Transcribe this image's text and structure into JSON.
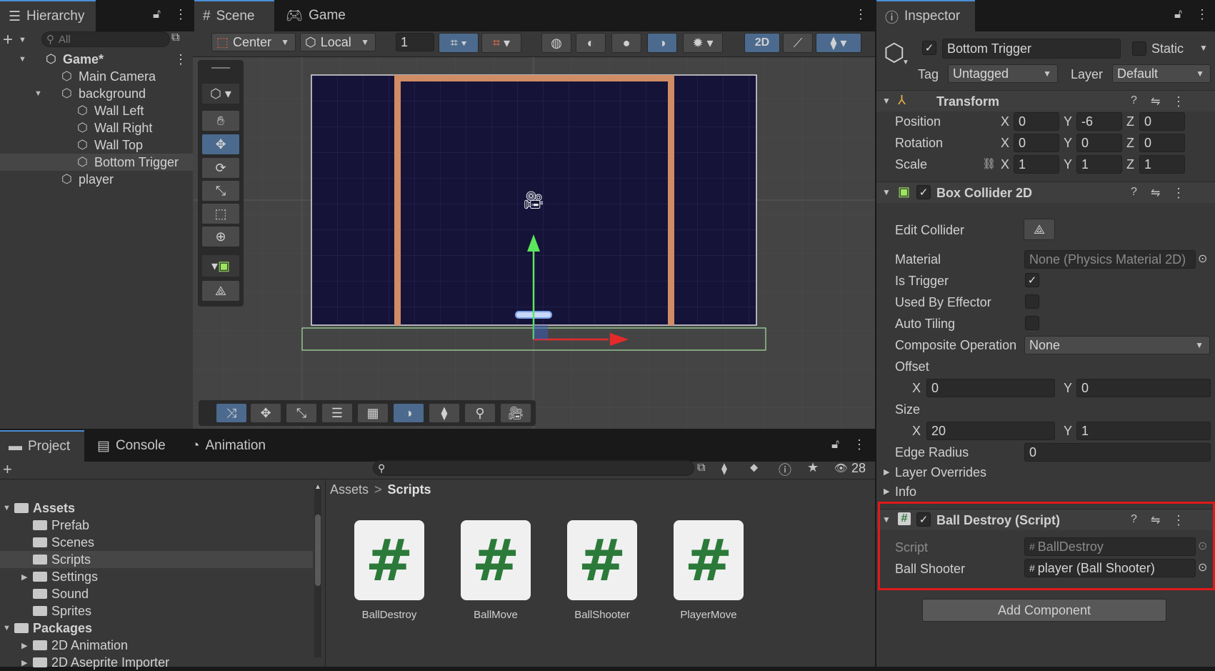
{
  "hierarchy": {
    "tab_label": "Hierarchy",
    "search_placeholder": "All",
    "items": [
      {
        "label": "Game*",
        "level": 0
      },
      {
        "label": "Main Camera",
        "level": 1
      },
      {
        "label": "background",
        "level": 1
      },
      {
        "label": "Wall Left",
        "level": 2
      },
      {
        "label": "Wall Right",
        "level": 2
      },
      {
        "label": "Wall Top",
        "level": 2
      },
      {
        "label": "Bottom Trigger",
        "level": 2
      },
      {
        "label": "player",
        "level": 1
      }
    ]
  },
  "scene": {
    "tabs": [
      "Scene",
      "Game"
    ],
    "pivot_label": "Center",
    "space_label": "Local",
    "snap_value": "1",
    "mode_2d_label": "2D"
  },
  "project": {
    "tabs": [
      "Project",
      "Console",
      "Animation"
    ],
    "visible_count": "28",
    "tree": [
      {
        "label": "Assets",
        "level": 0
      },
      {
        "label": "Prefab",
        "level": 1
      },
      {
        "label": "Scenes",
        "level": 1
      },
      {
        "label": "Scripts",
        "level": 1
      },
      {
        "label": "Settings",
        "level": 1
      },
      {
        "label": "Sound",
        "level": 1
      },
      {
        "label": "Sprites",
        "level": 1
      },
      {
        "label": "Packages",
        "level": 0
      },
      {
        "label": "2D Animation",
        "level": 1
      },
      {
        "label": "2D Aseprite Importer",
        "level": 1
      }
    ],
    "breadcrumb": {
      "root": "Assets",
      "current": "Scripts",
      "sep": ">"
    },
    "assets": [
      {
        "label": "BallDestroy",
        "glyph": "#"
      },
      {
        "label": "BallMove",
        "glyph": "#"
      },
      {
        "label": "BallShooter",
        "glyph": "#"
      },
      {
        "label": "PlayerMove",
        "glyph": "#"
      }
    ]
  },
  "inspector": {
    "tab_label": "Inspector",
    "object_name": "Bottom Trigger",
    "static_label": "Static",
    "tag_label": "Tag",
    "tag_value": "Untagged",
    "layer_label": "Layer",
    "layer_value": "Default",
    "transform": {
      "title": "Transform",
      "position_label": "Position",
      "rotation_label": "Rotation",
      "scale_label": "Scale",
      "axis": {
        "x": "X",
        "y": "Y",
        "z": "Z"
      },
      "position": {
        "x": "0",
        "y": "-6",
        "z": "0"
      },
      "rotation": {
        "x": "0",
        "y": "0",
        "z": "0"
      },
      "scale": {
        "x": "1",
        "y": "1",
        "z": "1"
      }
    },
    "box_collider": {
      "title": "Box Collider 2D",
      "edit_collider_label": "Edit Collider",
      "material_label": "Material",
      "material_value": "None (Physics Material 2D)",
      "is_trigger_label": "Is Trigger",
      "is_trigger_mark": "✓",
      "used_by_effector_label": "Used By Effector",
      "auto_tiling_label": "Auto Tiling",
      "composite_label": "Composite Operation",
      "composite_value": "None",
      "offset_label": "Offset",
      "offset": {
        "x": "0",
        "y": "0"
      },
      "size_label": "Size",
      "size": {
        "x": "20",
        "y": "1"
      },
      "edge_radius_label": "Edge Radius",
      "edge_radius_value": "0",
      "layer_overrides_label": "Layer Overrides",
      "info_label": "Info"
    },
    "ball_destroy": {
      "title": "Ball Destroy (Script)",
      "script_label": "Script",
      "script_value": "BallDestroy",
      "ball_shooter_label": "Ball Shooter",
      "ball_shooter_value": "player (Ball Shooter)"
    },
    "add_component_label": "Add Component"
  },
  "colors": {
    "highlight_box": "#e0191b",
    "selection": "#464646",
    "active_tool": "#4b6a8e",
    "accent": "#4a8ed4"
  }
}
